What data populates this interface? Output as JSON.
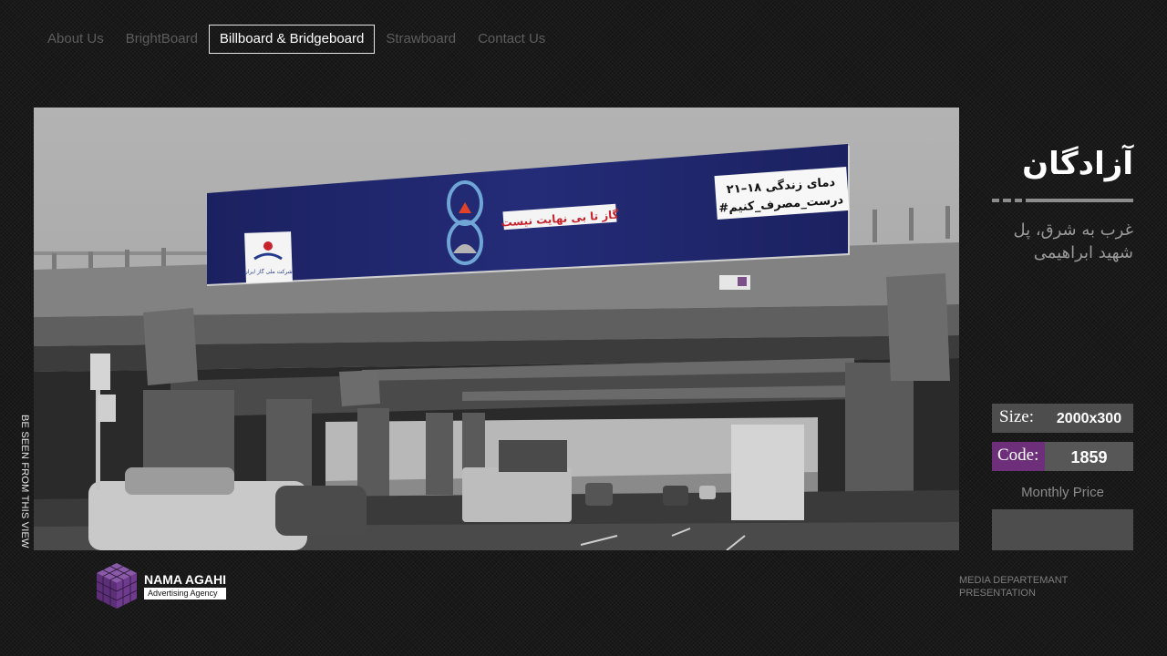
{
  "nav": {
    "items": [
      {
        "label": "About Us",
        "active": false
      },
      {
        "label": "BrightBoard",
        "active": false
      },
      {
        "label": "Billboard & Bridgeboard",
        "active": true
      },
      {
        "label": "Strawboard",
        "active": false
      },
      {
        "label": "Contact Us",
        "active": false
      }
    ]
  },
  "side_label": "BE SEEN FROM THIS VIEW",
  "billboard": {
    "slogan": "گاز تا بی نهایت نیست",
    "info_line1": "۲۱–۱۸ دمای زندگی",
    "info_line2": "#درست_مصرف_کنیم",
    "company": "شرکت ملی گاز ایران"
  },
  "location": {
    "title": "آزادگان",
    "subtitle": "غرب به شرق، پل شهید ابراهیمی"
  },
  "specs": {
    "size_label": "Size:",
    "size_value": "2000x300",
    "code_label": "Code:",
    "code_value": "1859",
    "price_label": "Monthly Price",
    "price_value": ""
  },
  "brand": {
    "name": "NAMA AGAHI",
    "tagline": "Advertising Agency"
  },
  "footer": {
    "line1": "MEDIA DEPARTEMANT",
    "line2": "PRESENTATION"
  },
  "colors": {
    "accent_purple": "#6e2f7a",
    "billboard_navy": "#1e2566",
    "panel_gray": "#4d4d4d"
  }
}
